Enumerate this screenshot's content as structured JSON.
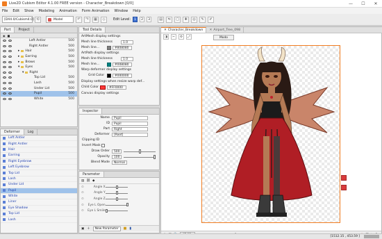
{
  "window": {
    "title": "Live2D Cubism Editor 4.1.00   FREE version  - Character_Breakdown [0/0]"
  },
  "menu": [
    "File",
    "Edit",
    "Show",
    "Modeling",
    "Animation",
    "Form Animation",
    "Window",
    "Help"
  ],
  "toolbar": {
    "workspace": "[DX4.0/Cubism4.0]",
    "mode": "Model",
    "edit_level_label": "Edit Level:",
    "levels": [
      "1",
      "2",
      "3"
    ]
  },
  "part_panel": {
    "tabs": [
      "Part",
      "Project"
    ],
    "rows": [
      {
        "label": "Left Antler",
        "num": "500"
      },
      {
        "label": "Right Antler",
        "num": "500"
      },
      {
        "label": "Hair",
        "num": "500"
      },
      {
        "label": "Earring",
        "num": "500"
      },
      {
        "label": "Brows",
        "num": "500"
      },
      {
        "label": "Eyes",
        "num": "500"
      },
      {
        "label": "Right",
        "num": ""
      },
      {
        "label": "Top Lid",
        "num": "500"
      },
      {
        "label": "Lash",
        "num": "500"
      },
      {
        "label": "Under Lid",
        "num": "500"
      },
      {
        "label": "Pupil",
        "num": "500"
      },
      {
        "label": "White",
        "num": "500"
      }
    ]
  },
  "deformer_panel": {
    "tabs": [
      "Deformer",
      "Log"
    ],
    "rows": [
      "Left Antler",
      "Right Antler",
      "Hair",
      "Earring",
      "Right Eyebrow",
      "Left Eyebrow",
      "Top Lid",
      "Lash",
      "Under Lid",
      "Pupil",
      "White",
      "Liner",
      "Eye Shadow",
      "Top Lid",
      "Lash"
    ]
  },
  "tool_detail": {
    "title": "Tool Details",
    "artmesh_title": "ArtMesh display settings",
    "mesh_thickness_label": "Mesh line thickness",
    "mesh_thickness_val": "1.0",
    "mesh_color_label": "Mesh line...",
    "mesh_color_val": "#808080",
    "artpath_title": "ArtPath display settings",
    "path_thickness_label": "Mesh line thickness",
    "path_thickness_val": "1.0",
    "path_color_label": "Mesh line...",
    "path_color_val": "#008080",
    "warp_title": "Warp deformer display settings",
    "grid_color_label": "Grid Color",
    "grid_color_val": "#000000",
    "resize_title": "Display settings when resize warp def...",
    "child_color_label": "Child Color",
    "child_color_val": "#FF0000",
    "canvas_title": "Canvas display settings"
  },
  "inspector": {
    "title": "Inspector",
    "name_label": "Name",
    "name_val": "Pupil",
    "id_label": "ID",
    "id_val": "Pupil",
    "part_label": "Part",
    "part_val": "Right",
    "deformer_label": "Deformer",
    "deformer_val": "[Root]",
    "clipping_label": "Clipping ID",
    "invert_label": "Invert Mask",
    "draw_label": "Draw Order",
    "draw_val": "500",
    "opacity_label": "Opacity",
    "opacity_val": "100",
    "blend_label": "Blend Mode",
    "blend_val": "Normal"
  },
  "parameter": {
    "title": "Parameter",
    "rows": [
      "Angle X",
      "Angle Y",
      "Angle Z",
      "Eye L Open",
      "Eye L Smile"
    ],
    "knob_fraction": [
      0.5,
      0.5,
      0.5,
      1.0,
      0.0
    ],
    "new_param_label": "New Parameter"
  },
  "canvas": {
    "tabs": [
      "Character_Breakdown",
      "Airport_Tree_098"
    ],
    "mode_label": "Modo",
    "zoom": "47.93",
    "coord": "[1512.15 , 453.59 ]"
  },
  "colors": {
    "accent": "#f07c20",
    "selection": "#9fc2ea",
    "deformer_text": "#1f3fb0"
  }
}
